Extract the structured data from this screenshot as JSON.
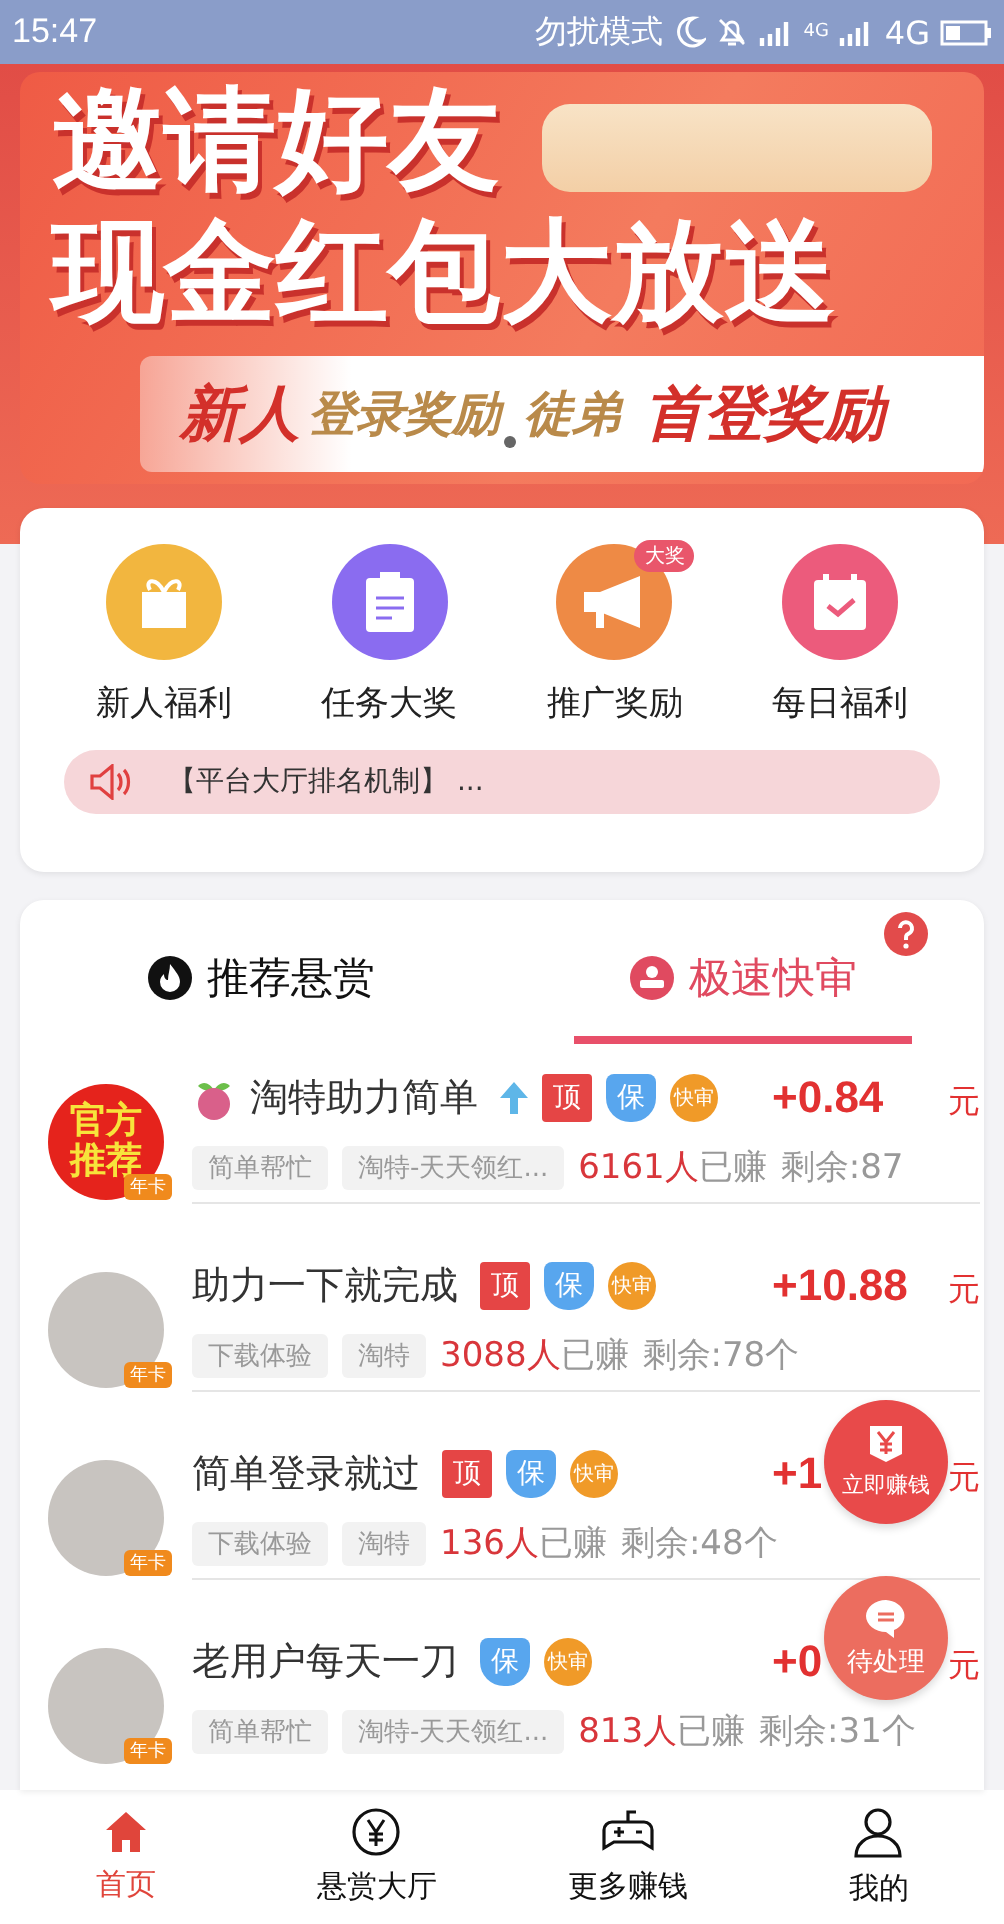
{
  "status_bar": {
    "time": "15:47",
    "mode": "勿扰模式",
    "network_small": "4G",
    "network": "4G"
  },
  "banner": {
    "title_lines": [
      "邀请好友",
      "现金红包大放送"
    ],
    "strip": [
      {
        "text": "新人",
        "kind": "strong"
      },
      {
        "text": "登录奖励",
        "kind": "soft"
      },
      {
        "text": "徒弟",
        "kind": "soft"
      },
      {
        "text": "首登奖励",
        "kind": "strong"
      }
    ]
  },
  "shortcuts": [
    {
      "label": "新人福利",
      "kind": "gift",
      "color": "#f2b63f"
    },
    {
      "label": "任务大奖",
      "kind": "clipboard",
      "color": "#8a6cf0"
    },
    {
      "label": "推广奖励",
      "kind": "megaphone",
      "color": "#ee8a45",
      "badge": "大奖"
    },
    {
      "label": "每日福利",
      "kind": "calendar",
      "color": "#ec5b7c"
    }
  ],
  "notice": {
    "text": "【平台大厅排名机制】 ..."
  },
  "tabs": [
    {
      "label": "推荐悬赏",
      "kind": "fire",
      "selected": false
    },
    {
      "label": "极速快审",
      "kind": "stamp",
      "selected": true
    }
  ],
  "tasks": [
    {
      "avatar": {
        "kind": "official",
        "text_lines": [
          "官方",
          "推荐"
        ],
        "badge": "年卡"
      },
      "fruit_icon": true,
      "name": "淘特助力简单",
      "up_arrow": true,
      "badges": [
        {
          "kind": "top",
          "label": "顶"
        },
        {
          "kind": "guarantee",
          "label": "保"
        },
        {
          "kind": "fast",
          "label": "快审"
        }
      ],
      "reward": {
        "amount": "+0.84",
        "unit": "元"
      },
      "tags": [
        "简单帮忙",
        "淘特-天天领红..."
      ],
      "earned_count": "6161人",
      "earned_label": "已赚",
      "remaining": "剩余:87"
    },
    {
      "avatar": {
        "kind": "photo",
        "badge": "年卡"
      },
      "fruit_icon": false,
      "name": "助力一下就完成",
      "up_arrow": false,
      "badges": [
        {
          "kind": "top",
          "label": "顶"
        },
        {
          "kind": "guarantee",
          "label": "保"
        },
        {
          "kind": "fast",
          "label": "快审"
        }
      ],
      "reward": {
        "amount": "+10.88",
        "unit": "元"
      },
      "tags": [
        "下载体验",
        "淘特"
      ],
      "earned_count": "3088人",
      "earned_label": "已赚",
      "remaining": "剩余:78个"
    },
    {
      "avatar": {
        "kind": "photo",
        "badge": "年卡"
      },
      "fruit_icon": false,
      "name": "简单登录就过",
      "up_arrow": false,
      "badges": [
        {
          "kind": "top",
          "label": "顶"
        },
        {
          "kind": "guarantee",
          "label": "保"
        },
        {
          "kind": "fast",
          "label": "快审"
        }
      ],
      "reward": {
        "amount": "+1",
        "unit": "元"
      },
      "tags": [
        "下载体验",
        "淘特"
      ],
      "earned_count": "136人",
      "earned_label": "已赚",
      "remaining": "剩余:48个"
    },
    {
      "avatar": {
        "kind": "photo",
        "badge": "年卡"
      },
      "fruit_icon": false,
      "name": "老用户每天一刀",
      "up_arrow": false,
      "badges": [
        {
          "kind": "guarantee",
          "label": "保"
        },
        {
          "kind": "fast",
          "label": "快审"
        }
      ],
      "reward": {
        "amount": "+0",
        "unit": "元"
      },
      "tags": [
        "简单帮忙",
        "淘特-天天领红..."
      ],
      "earned_count": "813人",
      "earned_label": "已赚",
      "remaining": "剩余:31个"
    }
  ],
  "floating_buttons": [
    {
      "kind": "earn",
      "label": "立即赚钱"
    },
    {
      "kind": "pending",
      "label": "待处理"
    }
  ],
  "bottom_nav": [
    {
      "label": "首页",
      "kind": "home",
      "selected": true
    },
    {
      "label": "悬赏大厅",
      "kind": "yen",
      "selected": false
    },
    {
      "label": "更多赚钱",
      "kind": "gamepad",
      "selected": false
    },
    {
      "label": "我的",
      "kind": "user",
      "selected": false
    }
  ]
}
